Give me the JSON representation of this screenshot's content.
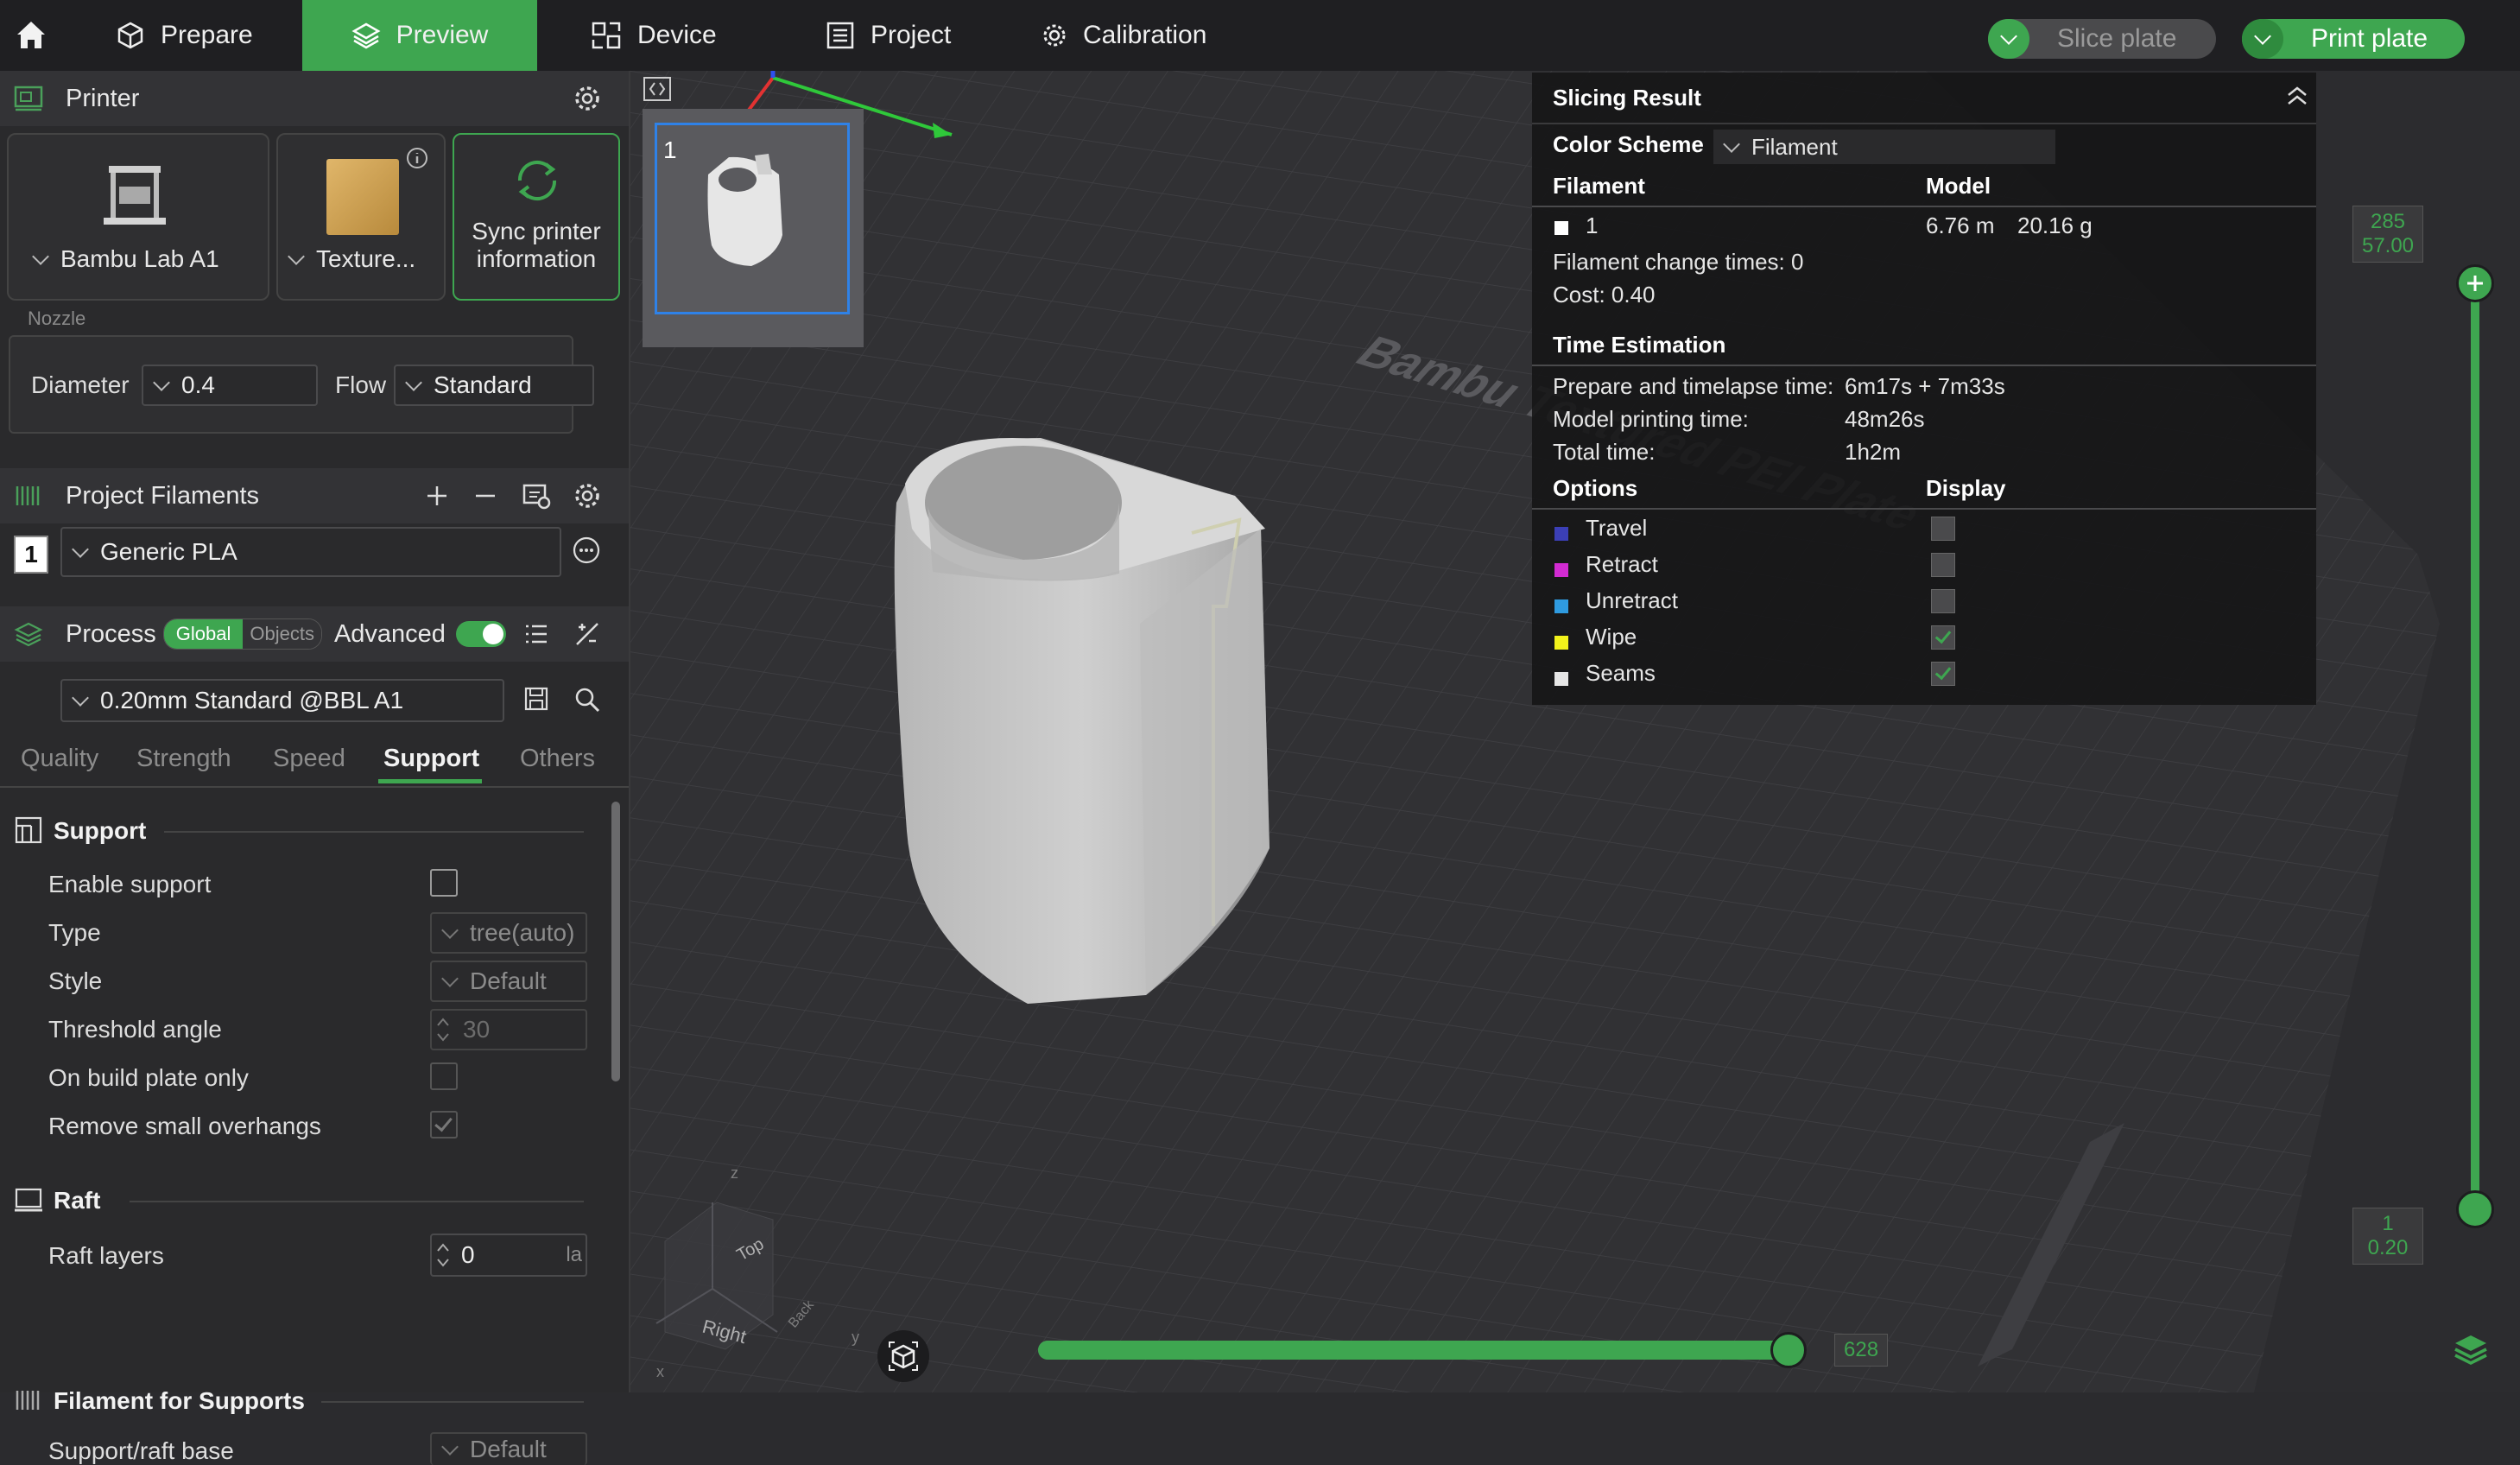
{
  "topbar": {
    "tabs": {
      "prepare": "Prepare",
      "preview": "Preview",
      "device": "Device",
      "project": "Project",
      "calibration": "Calibration"
    },
    "slice_label": "Slice plate",
    "print_label": "Print plate",
    "accent": "#3ea650"
  },
  "printer": {
    "title": "Printer",
    "model": "Bambu Lab A1",
    "plate": "Texture...",
    "sync": "Sync printer information",
    "nozzle_group": "Nozzle",
    "diameter_label": "Diameter",
    "diameter_value": "0.4",
    "flow_label": "Flow",
    "flow_value": "Standard"
  },
  "filaments": {
    "title": "Project Filaments",
    "index": "1",
    "name": "Generic PLA"
  },
  "process": {
    "title": "Process",
    "global": "Global",
    "objects": "Objects",
    "advanced": "Advanced",
    "preset": "0.20mm Standard @BBL A1",
    "tabs": {
      "quality": "Quality",
      "strength": "Strength",
      "speed": "Speed",
      "support": "Support",
      "others": "Others"
    }
  },
  "support": {
    "title": "Support",
    "enable": "Enable support",
    "type_label": "Type",
    "type_value": "tree(auto)",
    "style_label": "Style",
    "style_value": "Default",
    "threshold_label": "Threshold angle",
    "threshold_value": "30",
    "plate_only": "On build plate only",
    "remove_small": "Remove small overhangs"
  },
  "raft": {
    "title": "Raft",
    "layers_label": "Raft layers",
    "layers_value": "0",
    "layers_unit": "la"
  },
  "filament_supports": {
    "title": "Filament for Supports",
    "base_label": "Support/raft base",
    "base_value": "Default"
  },
  "viewport": {
    "plate_number": "1",
    "bed_text": "Bambu Textured PEI Plate",
    "axis_top": "Top",
    "axis_right": "Right",
    "axis_back": "Back",
    "axis_z": "z",
    "axis_y": "y",
    "axis_x": "x",
    "layer_top_index": "285",
    "layer_top_height": "57.00",
    "layer_bottom_index": "1",
    "layer_bottom_height": "0.20",
    "move_count": "628",
    "layer_top_fraction": 1.0,
    "layer_bottom_fraction": 0.0,
    "move_fraction": 1.0
  },
  "slicing_result": {
    "title": "Slicing Result",
    "color_scheme_label": "Color Scheme",
    "color_scheme_value": "Filament",
    "filament_header": "Filament",
    "model_header": "Model",
    "filament_id": "1",
    "length": "6.76 m",
    "weight": "20.16 g",
    "change_times": "Filament change times:  0",
    "cost": "Cost:  0.40",
    "time_header": "Time Estimation",
    "prepare_label": "Prepare and timelapse time:",
    "prepare_value": "6m17s + 7m33s",
    "model_time_label": "Model printing time:",
    "model_time_value": "48m26s",
    "total_label": "Total time:",
    "total_value": "1h2m",
    "options_header": "Options",
    "display_header": "Display",
    "options": [
      {
        "label": "Travel",
        "color": "#3b3fb6"
      },
      {
        "label": "Retract",
        "color": "#d22bd2"
      },
      {
        "label": "Unretract",
        "color": "#2f9be0"
      },
      {
        "label": "Wipe",
        "color": "#f2f21b"
      },
      {
        "label": "Seams",
        "color": "#e6e6e6"
      }
    ]
  }
}
